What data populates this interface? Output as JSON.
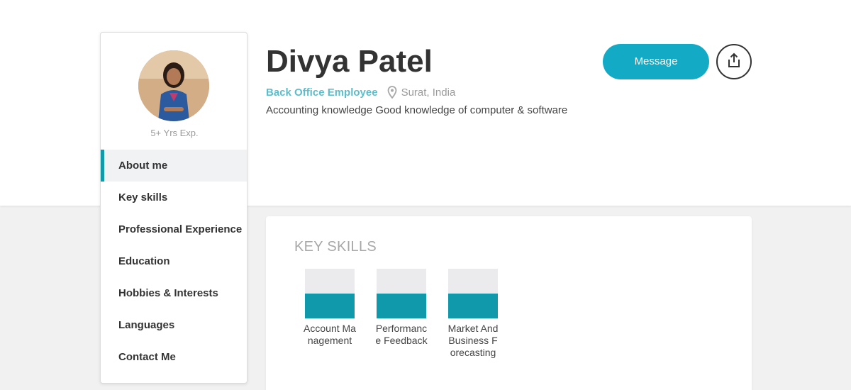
{
  "profile": {
    "name": "Divya Patel",
    "experience": "5+ Yrs Exp.",
    "job_title": "Back Office Employee",
    "location": "Surat, India",
    "summary": "Accounting knowledge Good knowledge of computer & software"
  },
  "actions": {
    "message_label": "Message",
    "share_icon": "share-icon"
  },
  "nav": {
    "items": [
      {
        "label": "About me",
        "active": true
      },
      {
        "label": "Key skills",
        "active": false
      },
      {
        "label": "Professional Experience",
        "active": false
      },
      {
        "label": "Education",
        "active": false
      },
      {
        "label": "Hobbies & Interests",
        "active": false
      },
      {
        "label": "Languages",
        "active": false
      },
      {
        "label": "Contact Me",
        "active": false
      }
    ]
  },
  "skills": {
    "title": "KEY SKILLS",
    "items": [
      {
        "label": "Account Management",
        "level": 0.5
      },
      {
        "label": "Performance Feedback",
        "level": 0.5
      },
      {
        "label": "Market And Business Forecasting",
        "level": 0.5
      }
    ]
  },
  "colors": {
    "accent": "#13aac6",
    "skill_fill": "#1098ab",
    "nav_active_bar": "#129aaa",
    "job_title": "#5dbdcb"
  }
}
